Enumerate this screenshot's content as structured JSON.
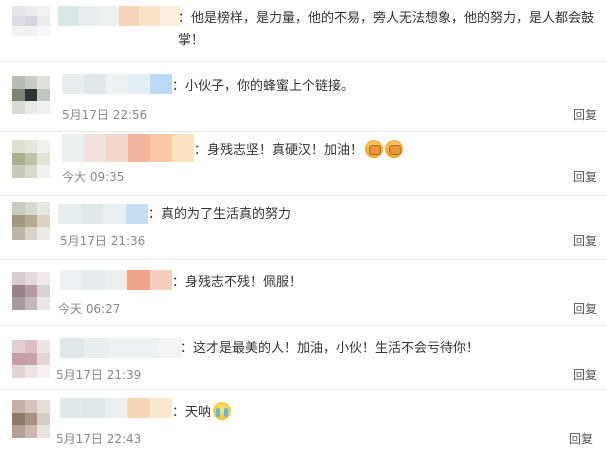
{
  "comments": [
    {
      "text": "：他是榜样，是力量，他的不易，旁人无法想象，他的努力，是人都会鼓掌！",
      "time": "",
      "reply": ""
    },
    {
      "text": "：小伙子，你的蜂蜜上个链接。",
      "time": "5月17日 22:56",
      "reply": "回复"
    },
    {
      "text": "：身残志坚！真硬汉！加油！",
      "time": "今大 09:35",
      "reply": "回复",
      "emojis": [
        "fist-emoji",
        "fist-emoji"
      ]
    },
    {
      "text": "：真的为了生活真的努力",
      "time": "5月17日 21:36",
      "reply": "回复"
    },
    {
      "text": "：身残志不残！佩服！",
      "time": "今天 06:27",
      "reply": "回复"
    },
    {
      "text": "：这才是最美的人！加油，小伙！生活不会亏待你！",
      "time": "5月17日 21:39",
      "reply": "回复"
    },
    {
      "text": "：天呐",
      "time": "5月17日 22:43",
      "reply": "回复",
      "emojis": [
        "crying-emoji"
      ]
    }
  ],
  "colors": {
    "text": "#333333",
    "time": "#888888",
    "divider": "#e8e8e8"
  }
}
